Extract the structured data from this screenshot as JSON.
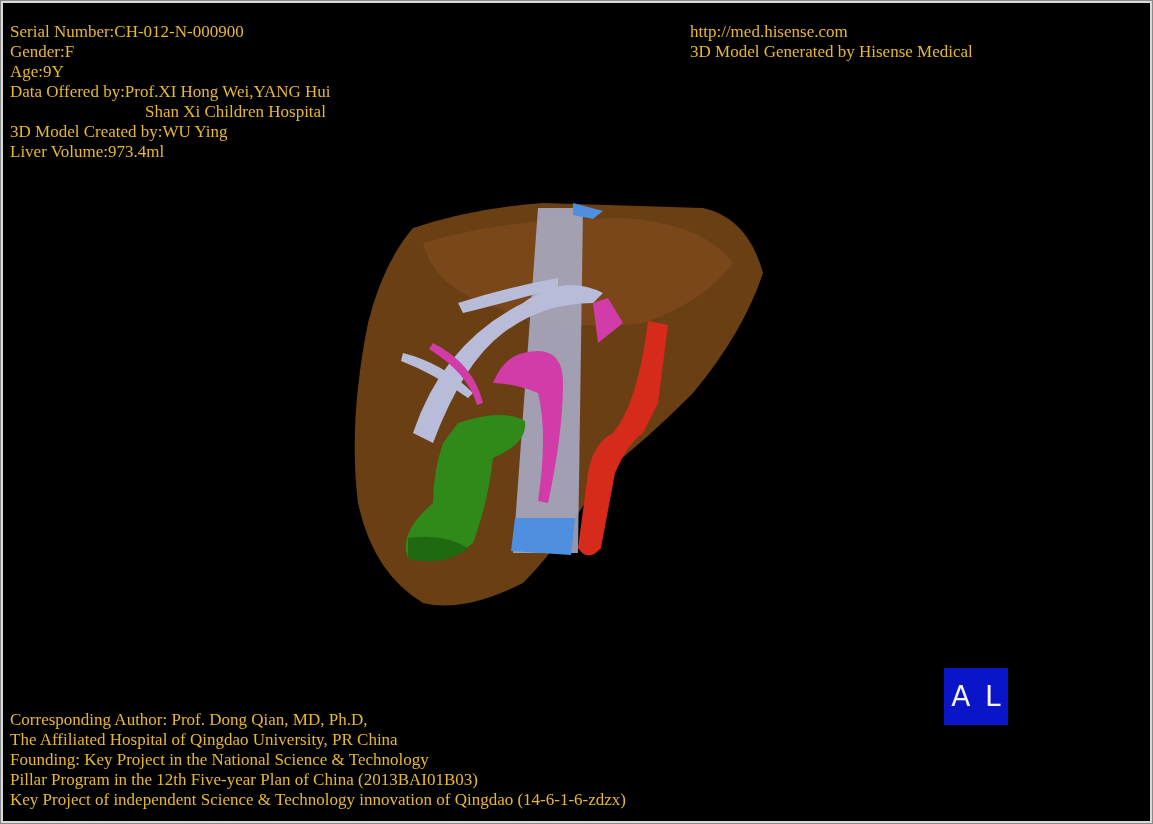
{
  "patient_info": [
    {
      "kind": "line",
      "text": "Serial Number:CH-012-N-000900"
    },
    {
      "kind": "line",
      "text": "Gender:F"
    },
    {
      "kind": "line",
      "text": "Age:9Y"
    },
    {
      "kind": "line",
      "text": "Data Offered by:Prof.XI Hong Wei,YANG Hui"
    },
    {
      "kind": "continuation",
      "text": "Shan Xi Children Hospital"
    },
    {
      "kind": "line",
      "text": "3D Model Created by:WU Ying"
    },
    {
      "kind": "line",
      "text": "Liver Volume:973.4ml"
    }
  ],
  "credits": [
    "http://med.hisense.com",
    "3D Model Generated by Hisense Medical"
  ],
  "footer_lines": [
    "Corresponding Author: Prof. Dong Qian, MD, Ph.D,",
    "The Affiliated Hospital of Qingdao University, PR China",
    "Founding: Key Project in the National Science & Technology",
    "Pillar Program in the 12th Five-year Plan of China (2013BAI01B03)",
    "Key Project of independent Science & Technology innovation of Qingdao (14-6-1-6-zdzx)"
  ],
  "orientation_cube": {
    "faces": [
      "A",
      "L"
    ]
  }
}
